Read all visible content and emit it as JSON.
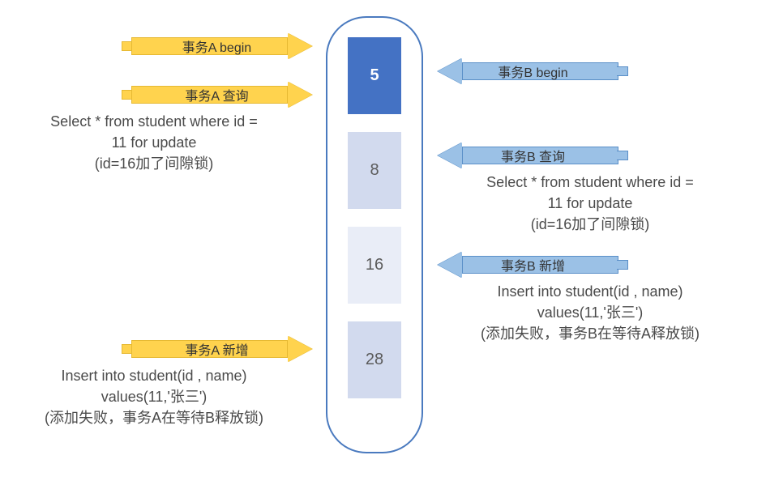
{
  "column": {
    "values": [
      "5",
      "8",
      "16",
      "28"
    ]
  },
  "left": {
    "arrows": [
      {
        "label": "事务A begin"
      },
      {
        "label": "事务A 查询"
      },
      {
        "label": "事务A 新增"
      }
    ],
    "captions": {
      "query": {
        "line1": "Select * from student where id =",
        "line2": "11 for update",
        "line3": "(id=16加了间隙锁)"
      },
      "insert": {
        "line1": "Insert into student(id , name)",
        "line2": "values(11,'张三')",
        "line3": "(添加失败，事务A在等待B释放锁)"
      }
    }
  },
  "right": {
    "arrows": [
      {
        "label": "事务B begin"
      },
      {
        "label": "事务B 查询"
      },
      {
        "label": "事务B 新增"
      }
    ],
    "captions": {
      "query": {
        "line1": "Select * from student where id =",
        "line2": "11 for update",
        "line3": "(id=16加了间隙锁)"
      },
      "insert": {
        "line1": "Insert into student(id , name)",
        "line2": "values(11,'张三')",
        "line3": "(添加失败，事务B在等待A释放锁)"
      }
    }
  }
}
